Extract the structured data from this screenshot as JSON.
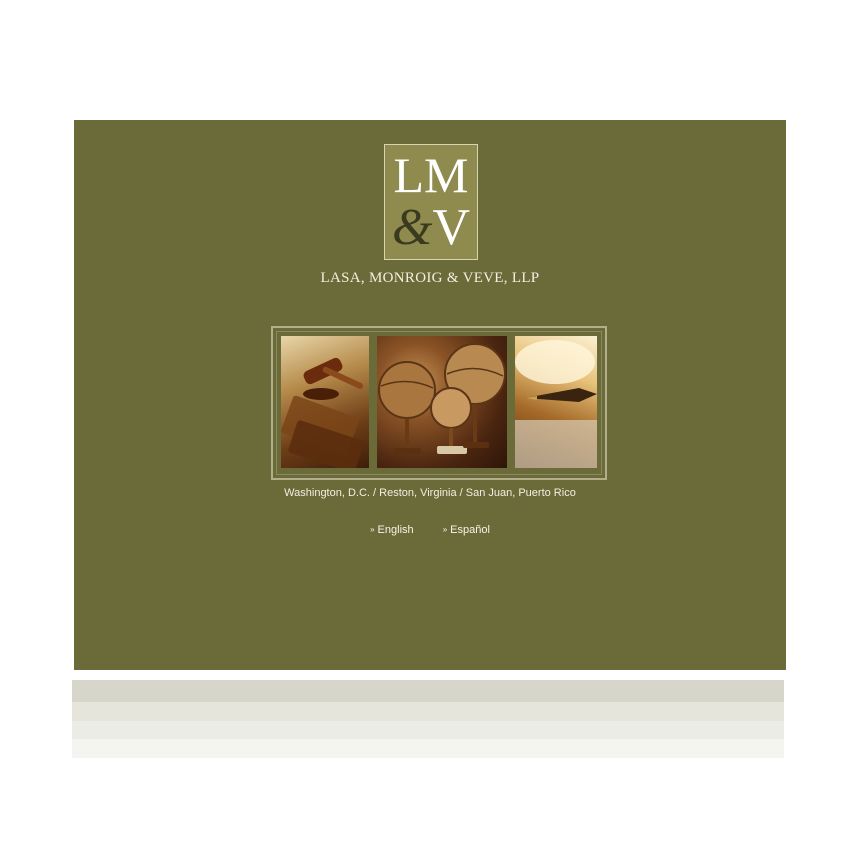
{
  "logo": {
    "line1": "LM",
    "ampersand": "&",
    "line2_letter": "V"
  },
  "firm_name": "LASA, MONROIG & VEVE, LLP",
  "photos": [
    {
      "name": "gavel-and-book-photo"
    },
    {
      "name": "antique-globes-photo"
    },
    {
      "name": "fountain-pen-photo"
    }
  ],
  "locations": "Washington, D.C. / Reston, Virginia / San Juan, Puerto Rico",
  "languages": {
    "chevron": "»",
    "english": "English",
    "spanish": "Español"
  },
  "colors": {
    "panel_background": "#6b6b3a",
    "logo_background": "#8f8a4e",
    "text": "#f1efe0"
  }
}
